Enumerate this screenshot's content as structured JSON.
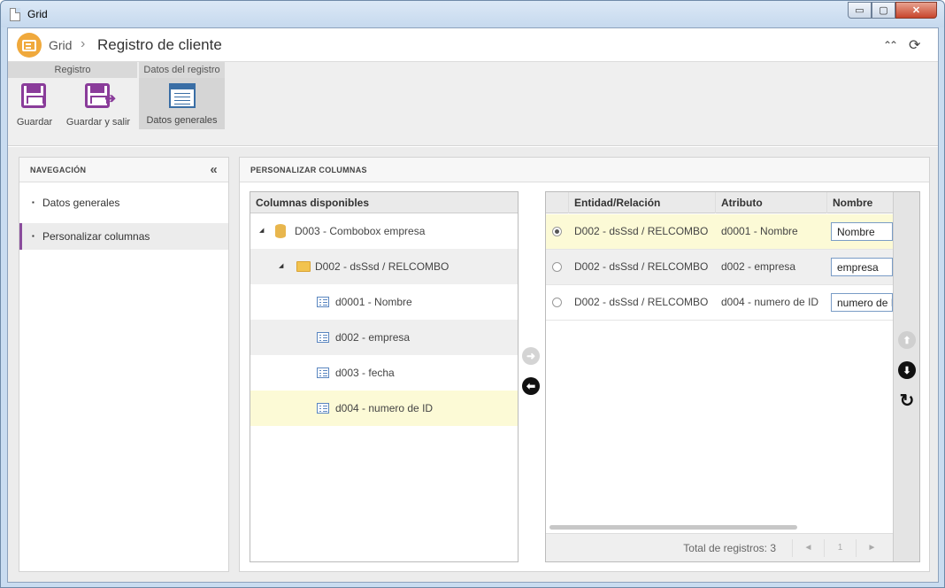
{
  "window": {
    "title": "Grid",
    "controls": {
      "minimize": "▭",
      "maximize": "▢",
      "close": "✕"
    }
  },
  "header": {
    "breadcrumb": "Grid",
    "separator": "›",
    "title": "Registro de cliente",
    "collapse_icon": "⌃⌃",
    "refresh_icon": "⟳"
  },
  "ribbon": {
    "groups": [
      {
        "title": "Registro"
      },
      {
        "title": "Datos del registro"
      }
    ],
    "buttons": {
      "save": "Guardar",
      "save_exit": "Guardar y salir",
      "general_data": "Datos generales"
    }
  },
  "navigation": {
    "title": "NAVEGACIÓN",
    "collapse": "«",
    "items": [
      {
        "label": "Datos generales",
        "active": false
      },
      {
        "label": "Personalizar columnas",
        "active": true
      }
    ]
  },
  "main": {
    "title": "PERSONALIZAR COLUMNAS",
    "tree": {
      "header": "Columnas disponibles",
      "nodes": [
        {
          "label": "D003 - Combobox empresa",
          "icon": "database-icon"
        },
        {
          "label": "D002 - dsSsd / RELCOMBO",
          "icon": "folder-icon"
        },
        {
          "label": "d0001 - Nombre",
          "icon": "field-icon"
        },
        {
          "label": "d002 - empresa",
          "icon": "field-icon"
        },
        {
          "label": "d003 - fecha",
          "icon": "field-icon"
        },
        {
          "label": "d004 - numero de ID",
          "icon": "field-icon"
        }
      ]
    },
    "grid": {
      "columns": [
        "Entidad/Relación",
        "Atributo",
        "Nombre"
      ],
      "rows": [
        {
          "entity": "D002 - dsSsd / RELCOMBO",
          "attribute": "d0001 - Nombre",
          "name": "Nombre",
          "selected": true
        },
        {
          "entity": "D002 - dsSsd / RELCOMBO",
          "attribute": "d002 - empresa",
          "name": "empresa",
          "selected": false
        },
        {
          "entity": "D002 - dsSsd / RELCOMBO",
          "attribute": "d004 - numero de ID",
          "name": "numero de ID",
          "selected": false
        }
      ],
      "total": "Total de registros: 3",
      "page": "1",
      "prev": "◄",
      "next": "►"
    }
  },
  "colors": {
    "accent": "#8a4c9c",
    "logo": "#f0a93c",
    "highlight": "#fcfad6"
  }
}
